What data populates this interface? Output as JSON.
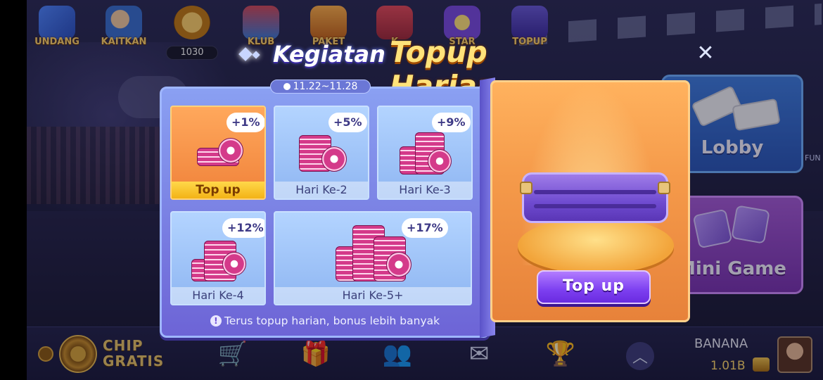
{
  "top_bar": {
    "icons": [
      {
        "label": "UNDANG",
        "icon": "envelope-icon"
      },
      {
        "label": "KAITKAN",
        "icon": "facebook-link-icon"
      },
      {
        "label": "",
        "icon": "rp-ticket-icon"
      },
      {
        "label": "KLUB",
        "icon": "club-building-icon"
      },
      {
        "label": "PAKET",
        "icon": "package-icon"
      },
      {
        "label": "K",
        "icon": "coupon-icon"
      },
      {
        "label": "STAR",
        "icon": "star-icon"
      },
      {
        "label": "TOPUP",
        "icon": "topup-icon"
      }
    ],
    "counter": "1030"
  },
  "modal": {
    "title_part1": "Kegiatan",
    "title_part2": "Topup Harian",
    "date_range": "11.22~11.28",
    "close_symbol": "✕",
    "days": [
      {
        "label": "Top up",
        "bonus": "+1%",
        "active": true
      },
      {
        "label": "Hari Ke-2",
        "bonus": "+5%",
        "active": false
      },
      {
        "label": "Hari Ke-3",
        "bonus": "+9%",
        "active": false
      },
      {
        "label": "Hari Ke-4",
        "bonus": "+12%",
        "active": false
      },
      {
        "label": "Hari Ke-5+",
        "bonus": "+17%",
        "active": false
      }
    ],
    "note": "Terus topup harian, bonus lebih banyak",
    "note_icon": "!",
    "topup_button": "Top up"
  },
  "tiles": {
    "lobby": "Lobby",
    "mini_game": "Mini Game",
    "side_label": "FUN"
  },
  "bottom_bar": {
    "chip_gratis_line1": "CHIP",
    "chip_gratis_line2": "GRATIS",
    "nav_icons": [
      "cart-icon",
      "gift-icon",
      "friends-icon",
      "mail-icon",
      "trophy-icon",
      "chevron-up-icon"
    ],
    "player_name": "BANANA",
    "player_coins": "1.01B"
  },
  "colors": {
    "accent_gold": "#ffe27a",
    "panel_blue": "#8aa0f2",
    "reward_orange": "#f59a4a",
    "button_purple": "#7c3ff0"
  }
}
